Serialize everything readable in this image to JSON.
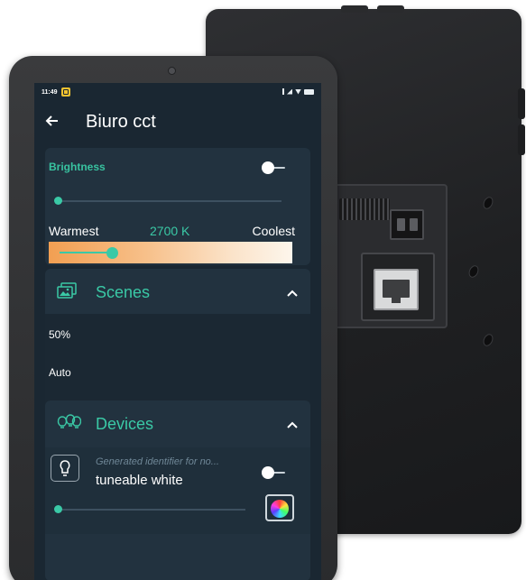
{
  "status_bar": {
    "time": "11:49"
  },
  "app_bar": {
    "back_icon": "arrow-left-icon",
    "title": "Biuro cct"
  },
  "brightness": {
    "label": "Brightness",
    "toggle_on": true,
    "level": 0.0
  },
  "color_temperature": {
    "warm_label": "Warmest",
    "value_label": "2700 K",
    "cool_label": "Coolest",
    "level": 0.25
  },
  "scenes": {
    "title": "Scenes",
    "icon": "image-gallery-icon",
    "items": [
      {
        "label": "50%"
      },
      {
        "label": "Auto"
      }
    ]
  },
  "devices": {
    "title": "Devices",
    "icon": "bulbs-icon",
    "items": [
      {
        "subtitle": "Generated identifier for no...",
        "name": "tuneable white",
        "icon": "bulb-icon",
        "color_icon": "color-wheel-icon"
      }
    ]
  },
  "colors": {
    "accent": "#3ac9a6",
    "background": "#1a2732",
    "card": "#22323f"
  }
}
